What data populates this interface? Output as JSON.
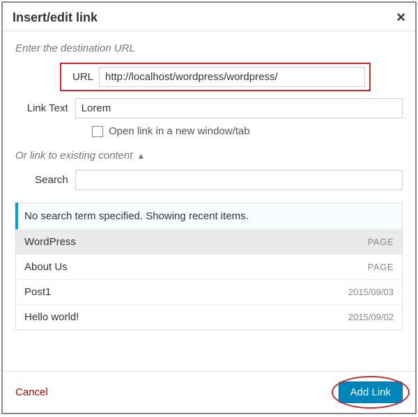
{
  "header": {
    "title": "Insert/edit link"
  },
  "section_destination_label": "Enter the destination URL",
  "url": {
    "label": "URL",
    "value": "http://localhost/wordpress/wordpress/"
  },
  "linktext": {
    "label": "Link Text",
    "value": "Lorem"
  },
  "newtab": {
    "label": "Open link in a new window/tab",
    "checked": false
  },
  "existing_toggle_label": "Or link to existing content",
  "search": {
    "label": "Search",
    "value": ""
  },
  "results": {
    "header": "No search term specified. Showing recent items.",
    "items": [
      {
        "title": "WordPress",
        "meta": "PAGE",
        "selected": true
      },
      {
        "title": "About Us",
        "meta": "PAGE",
        "selected": false
      },
      {
        "title": "Post1",
        "meta": "2015/09/03",
        "selected": false
      },
      {
        "title": "Hello world!",
        "meta": "2015/09/02",
        "selected": false
      }
    ]
  },
  "footer": {
    "cancel": "Cancel",
    "addlink": "Add Link"
  }
}
